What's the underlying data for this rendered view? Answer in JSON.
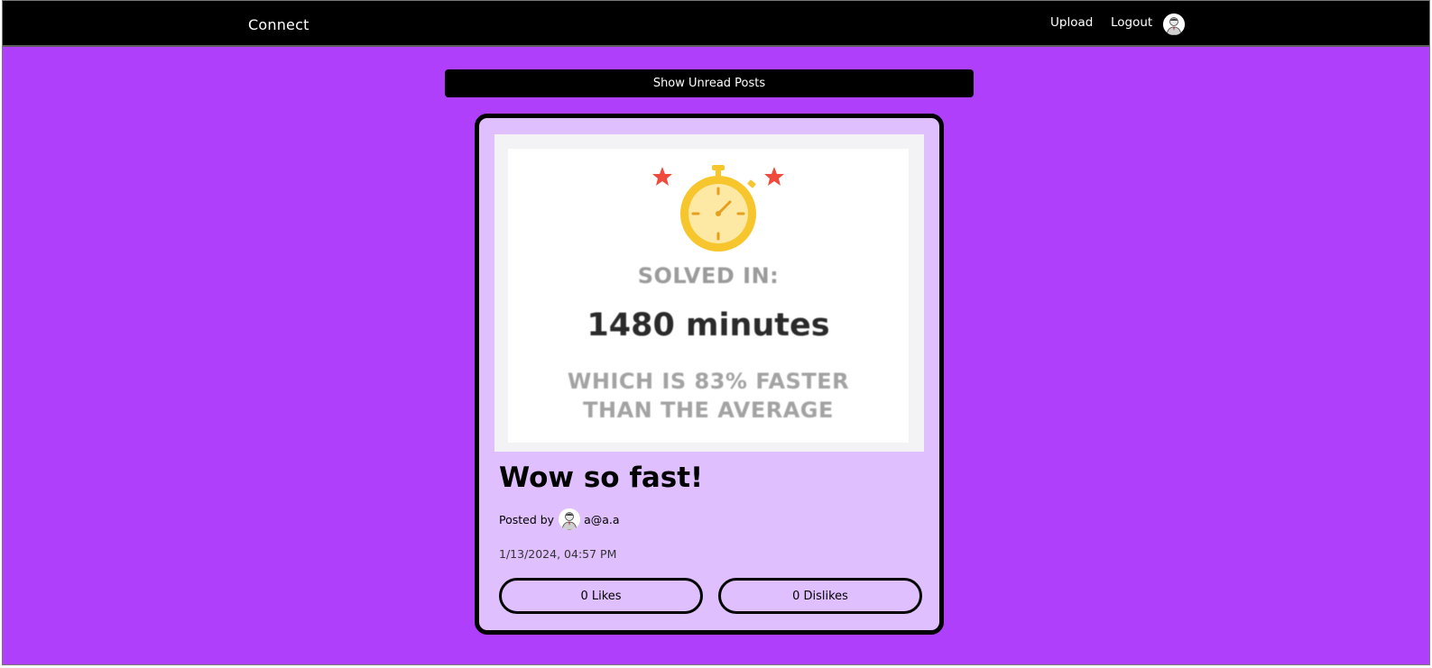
{
  "header": {
    "brand": "Connect",
    "upload_label": "Upload",
    "logout_label": "Logout",
    "avatar_icon": "user-avatar-icon"
  },
  "main": {
    "unread_button_label": "Show Unread Posts"
  },
  "post": {
    "image": {
      "line1": "SOLVED IN:",
      "line2": "1480 minutes",
      "line3": "WHICH IS 83% FASTER",
      "line4": "THAN THE AVERAGE",
      "icon": "stopwatch-icon",
      "colors": {
        "stopwatch": "#f7c52c",
        "star": "#f04a3c"
      }
    },
    "title": "Wow so fast!",
    "posted_by_label": "Posted by",
    "author": "a@a.a",
    "date": "1/13/2024, 04:57 PM",
    "likes_label": "0 Likes",
    "dislikes_label": "0 Dislikes"
  },
  "colors": {
    "background": "#b03ffc",
    "card": "#dfbffd",
    "topbar": "#000000"
  }
}
